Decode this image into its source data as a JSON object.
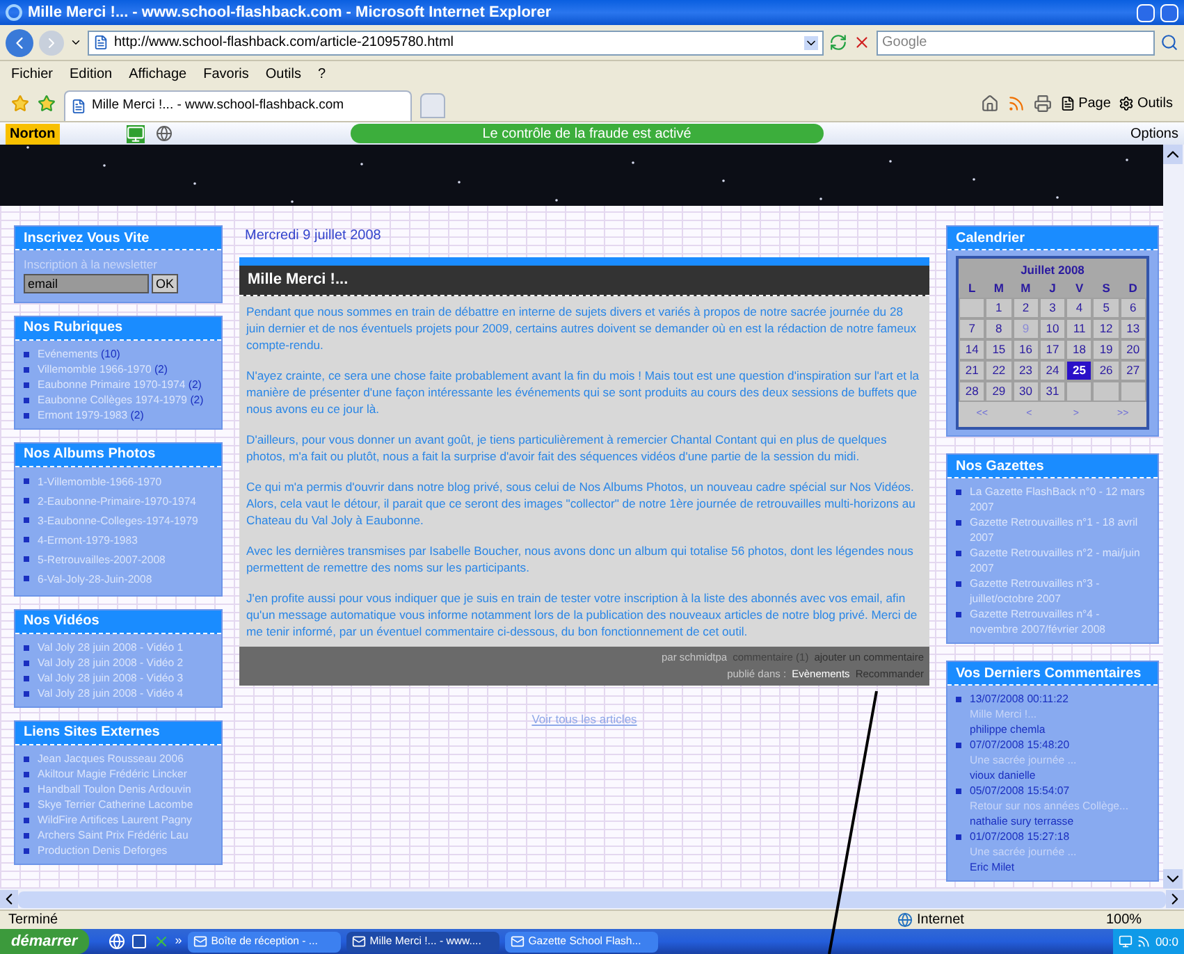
{
  "window": {
    "title": "Mille Merci !... - www.school-flashback.com - Microsoft Internet Explorer"
  },
  "address_bar": {
    "url": "http://www.school-flashback.com/article-21095780.html",
    "search_placeholder": "Google"
  },
  "menu": [
    "Fichier",
    "Edition",
    "Affichage",
    "Favoris",
    "Outils",
    "?"
  ],
  "tabs": [
    {
      "label": "Mille Merci !... - www.school-flashback.com",
      "selected": true
    }
  ],
  "toolbar": {
    "page": "Page",
    "tools": "Outils"
  },
  "norton": {
    "brand": "Norton",
    "status": "Le contrôle de la fraude est activé",
    "options": "Options"
  },
  "newsletter": {
    "title": "Inscrivez Vous Vite",
    "hint": "Inscription à la newsletter",
    "value": "email",
    "button": "OK"
  },
  "rubriques": {
    "title": "Nos Rubriques",
    "items": [
      {
        "label": "Evénements",
        "count": "(10)"
      },
      {
        "label": "Villemomble 1966-1970",
        "count": "(2)"
      },
      {
        "label": "Eaubonne Primaire 1970-1974",
        "count": "(2)"
      },
      {
        "label": "Eaubonne Collèges 1974-1979",
        "count": "(2)"
      },
      {
        "label": "Ermont 1979-1983",
        "count": "(2)"
      }
    ]
  },
  "albums": {
    "title": "Nos Albums Photos",
    "items": [
      "1-Villemomble-1966-1970",
      "2-Eaubonne-Primaire-1970-1974",
      "3-Eaubonne-Colleges-1974-1979",
      "4-Ermont-1979-1983",
      "5-Retrouvailles-2007-2008",
      "6-Val-Joly-28-Juin-2008"
    ]
  },
  "videos": {
    "title": "Nos Vidéos",
    "items": [
      "Val Joly 28 juin 2008 - Vidéo 1",
      "Val Joly 28 juin 2008 - Vidéo 2",
      "Val Joly 28 juin 2008 - Vidéo 3",
      "Val Joly 28 juin 2008 - Vidéo 4"
    ]
  },
  "links": {
    "title": "Liens Sites Externes",
    "items": [
      "Jean Jacques Rousseau 2006",
      "Akiltour Magie Frédéric Lincker",
      "Handball Toulon Denis Ardouvin",
      "Skye Terrier Catherine Lacombe",
      "WildFire Artifices Laurent Pagny",
      "Archers Saint Prix Frédéric Lau",
      "Production Denis Deforges"
    ]
  },
  "article": {
    "date": "Mercredi 9 juillet 2008",
    "title": "Mille Merci !...",
    "paragraphs": [
      "Pendant que nous sommes en train de débattre en interne de sujets divers et variés à propos de notre sacrée journée du 28 juin dernier et de nos éventuels projets pour 2009, certains autres doivent se demander où en est la rédaction de notre fameux compte-rendu.",
      "N'ayez crainte, ce sera une chose faite probablement avant la fin du mois ! Mais tout est une question d'inspiration sur l'art et la manière de présenter d'une façon intéressante les événements qui se sont produits au cours des deux sessions de buffets que nous avons eu ce jour là.",
      "D'ailleurs, pour vous donner un avant goût, je tiens particulièrement à remercier Chantal Contant qui en plus de quelques photos, m'a fait ou plutôt, nous a fait la surprise d'avoir fait des séquences vidéos d'une partie de la session du midi.",
      "Ce qui m'a permis d'ouvrir dans notre blog privé, sous celui de Nos Albums Photos, un nouveau cadre spécial sur Nos Vidéos. Alors, cela vaut le détour, il parait que ce seront des images \"collector\" de notre 1ère journée de retrouvailles multi-horizons au Chateau du Val Joly à Eaubonne.",
      "Avec les dernières transmises par Isabelle Boucher, nous avons donc un album qui totalise 56 photos, dont les légendes nous permettent de remettre des noms sur les participants.",
      "J'en profite aussi pour vous indiquer que je suis en train de tester votre inscription à la liste des abonnés avec vos email, afin qu'un message automatique vous informe notamment lors de la publication des nouveaux articles de notre blog privé. Merci de me tenir informé, par un éventuel commentaire ci-dessous, du bon fonctionnement de cet outil."
    ],
    "footer": {
      "byline": "par schmidtpa",
      "comments_link": "commentaire (1)",
      "add_comment_link": "ajouter un commentaire",
      "category_label": "publié dans :",
      "category_link": "Evènements",
      "recommend_link": "Recommander"
    },
    "all_articles_link": "Voir tous les articles"
  },
  "calendar": {
    "title": "Calendrier",
    "month": "Juillet 2008",
    "weekdays": [
      "L",
      "M",
      "M",
      "J",
      "V",
      "S",
      "D"
    ],
    "weeks": [
      {
        "days": [
          {
            "day": "1",
            "selected": false,
            "dim": false
          },
          {
            "day": "2",
            "selected": false,
            "dim": false
          },
          {
            "day": "3",
            "selected": false,
            "dim": false
          },
          {
            "day": "4",
            "selected": false,
            "dim": false
          },
          {
            "day": "5",
            "selected": false,
            "dim": false
          },
          {
            "day": "6",
            "selected": false,
            "dim": false
          }
        ]
      },
      {
        "days": [
          {
            "day": "7",
            "selected": false,
            "dim": false
          },
          {
            "day": "8",
            "selected": false,
            "dim": false
          },
          {
            "day": "9",
            "selected": false,
            "dim": true
          },
          {
            "day": "10",
            "selected": false,
            "dim": false
          },
          {
            "day": "11",
            "selected": false,
            "dim": false
          },
          {
            "day": "12",
            "selected": false,
            "dim": false
          },
          {
            "day": "13",
            "selected": false,
            "dim": false
          }
        ]
      },
      {
        "days": [
          {
            "day": "14",
            "selected": false,
            "dim": false
          },
          {
            "day": "15",
            "selected": false,
            "dim": false
          },
          {
            "day": "16",
            "selected": false,
            "dim": false
          },
          {
            "day": "17",
            "selected": false,
            "dim": false
          },
          {
            "day": "18",
            "selected": false,
            "dim": false
          },
          {
            "day": "19",
            "selected": false,
            "dim": false
          },
          {
            "day": "20",
            "selected": false,
            "dim": false
          }
        ]
      },
      {
        "days": [
          {
            "day": "21",
            "selected": false,
            "dim": false
          },
          {
            "day": "22",
            "selected": false,
            "dim": false
          },
          {
            "day": "23",
            "selected": false,
            "dim": false
          },
          {
            "day": "24",
            "selected": false,
            "dim": false
          },
          {
            "day": "25",
            "selected": true,
            "dim": false
          },
          {
            "day": "26",
            "selected": false,
            "dim": false
          },
          {
            "day": "27",
            "selected": false,
            "dim": false
          }
        ]
      },
      {
        "days": [
          {
            "day": "28",
            "selected": false,
            "dim": false
          },
          {
            "day": "29",
            "selected": false,
            "dim": false
          },
          {
            "day": "30",
            "selected": false,
            "dim": false
          },
          {
            "day": "31",
            "selected": false,
            "dim": false
          }
        ]
      }
    ],
    "nav": [
      "<<",
      "<",
      ">",
      ">>"
    ]
  },
  "gazettes": {
    "title": "Nos Gazettes",
    "items": [
      "La Gazette FlashBack n°0 - 12 mars 2007",
      "Gazette Retrouvailles n°1 - 18 avril 2007",
      "Gazette Retrouvailles n°2 - mai/juin 2007",
      "Gazette Retrouvailles n°3 - juillet/octobre 2007",
      "Gazette Retrouvailles n°4 - novembre 2007/février 2008"
    ]
  },
  "comments": {
    "title": "Vos Derniers Commentaires",
    "items": [
      {
        "date": "13/07/2008 00:11:22",
        "article": "Mille Merci !...",
        "author": "philippe chemla"
      },
      {
        "date": "07/07/2008 15:48:20",
        "article": "Une sacrée journée ...",
        "author": "vioux danielle"
      },
      {
        "date": "05/07/2008 15:54:07",
        "article": "Retour sur nos années Collège...",
        "author": "nathalie sury terrasse"
      },
      {
        "date": "01/07/2008 15:27:18",
        "article": "Une sacrée journée ...",
        "author": "Eric Milet"
      }
    ]
  },
  "status_bar": {
    "text": "Terminé",
    "zone": "Internet",
    "zoom": "100%"
  },
  "taskbar": {
    "start": "démarrer",
    "more": "»",
    "tasks": [
      {
        "label": "Boîte de réception - ...",
        "selected": false
      },
      {
        "label": "Mille Merci !... - www....",
        "selected": true
      },
      {
        "label": "Gazette School Flash...",
        "selected": false
      }
    ],
    "clock": "00:0"
  }
}
